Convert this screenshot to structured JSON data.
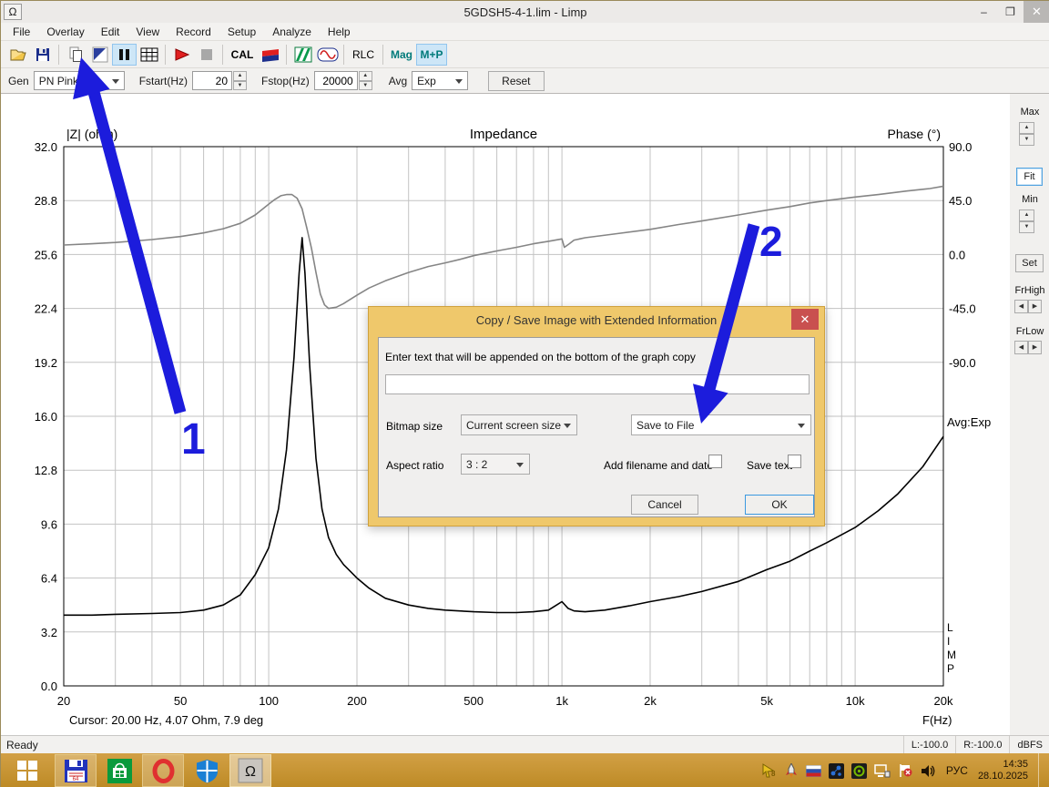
{
  "window": {
    "title": "5GDSH5-4-1.lim - Limp",
    "app_icon": "Ω"
  },
  "menu": {
    "items": [
      "File",
      "Overlay",
      "Edit",
      "View",
      "Record",
      "Setup",
      "Analyze",
      "Help"
    ]
  },
  "toolbar": {
    "icons": [
      "open-icon",
      "save-icon",
      "copy-icon",
      "pen-icon",
      "pause-icon",
      "table-icon",
      "record-icon",
      "stop-icon",
      "cal-button",
      "gen-flag-icon",
      "spectrum-icon",
      "generator-icon",
      "rlc-button",
      "mag-button",
      "mag-phase-button"
    ],
    "cal_label": "CAL",
    "rlc_label": "RLC",
    "mag_label": "Mag",
    "mp_label": "M+P"
  },
  "controls": {
    "gen_label": "Gen",
    "gen_value": "PN Pink",
    "fstart_label": "Fstart(Hz)",
    "fstart_value": "20",
    "fstop_label": "Fstop(Hz)",
    "fstop_value": "20000",
    "avg_label": "Avg",
    "avg_value": "Exp",
    "reset_label": "Reset"
  },
  "side_panel": {
    "max_label": "Max",
    "fit_label": "Fit",
    "min_label": "Min",
    "set_label": "Set",
    "frhigh_label": "FrHigh",
    "frlow_label": "FrLow"
  },
  "chart_data": {
    "type": "line",
    "title": "Impedance",
    "left_axis": {
      "label": "|Z| (ohm)",
      "range": [
        0,
        32
      ],
      "ticks": [
        "32.0",
        "28.8",
        "25.6",
        "22.4",
        "19.2",
        "16.0",
        "12.8",
        "9.6",
        "6.4",
        "3.2",
        "0.0"
      ]
    },
    "right_axis": {
      "label": "Phase (°)",
      "range": [
        -90,
        90
      ],
      "ticks": [
        "90.0",
        "45.0",
        "0.0",
        "-45.0",
        "-90.0"
      ]
    },
    "x_axis": {
      "label": "F(Hz)",
      "scale": "log",
      "range": [
        20,
        20000
      ],
      "ticks": [
        {
          "label": "20",
          "f": 20
        },
        {
          "label": "50",
          "f": 50
        },
        {
          "label": "100",
          "f": 100
        },
        {
          "label": "200",
          "f": 200
        },
        {
          "label": "500",
          "f": 500
        },
        {
          "label": "1k",
          "f": 1000
        },
        {
          "label": "2k",
          "f": 2000
        },
        {
          "label": "5k",
          "f": 5000
        },
        {
          "label": "10k",
          "f": 10000
        },
        {
          "label": "20k",
          "f": 20000
        }
      ]
    },
    "cursor_readout": "Cursor: 20.00 Hz, 4.07 Ohm, 7.9 deg",
    "avg_note": "Avg:Exp",
    "watermark": "LIMP",
    "grid": true,
    "series": [
      {
        "name": "impedance",
        "axis": "left",
        "color": "#000000",
        "unit": "Ohm",
        "points": [
          [
            20,
            4.2
          ],
          [
            25,
            4.2
          ],
          [
            30,
            4.25
          ],
          [
            40,
            4.3
          ],
          [
            50,
            4.35
          ],
          [
            60,
            4.5
          ],
          [
            70,
            4.8
          ],
          [
            80,
            5.4
          ],
          [
            90,
            6.6
          ],
          [
            100,
            8.2
          ],
          [
            108,
            10.5
          ],
          [
            115,
            14
          ],
          [
            122,
            19.5
          ],
          [
            127,
            24.5
          ],
          [
            130,
            26.6
          ],
          [
            133,
            24.5
          ],
          [
            138,
            19
          ],
          [
            145,
            13.5
          ],
          [
            152,
            10.5
          ],
          [
            160,
            8.8
          ],
          [
            170,
            7.8
          ],
          [
            180,
            7.2
          ],
          [
            200,
            6.4
          ],
          [
            220,
            5.8
          ],
          [
            250,
            5.2
          ],
          [
            300,
            4.8
          ],
          [
            350,
            4.6
          ],
          [
            400,
            4.5
          ],
          [
            500,
            4.4
          ],
          [
            600,
            4.35
          ],
          [
            700,
            4.35
          ],
          [
            800,
            4.4
          ],
          [
            850,
            4.45
          ],
          [
            900,
            4.5
          ],
          [
            950,
            4.75
          ],
          [
            1000,
            5.0
          ],
          [
            1050,
            4.6
          ],
          [
            1100,
            4.45
          ],
          [
            1200,
            4.4
          ],
          [
            1400,
            4.5
          ],
          [
            1700,
            4.75
          ],
          [
            2000,
            5.0
          ],
          [
            2500,
            5.3
          ],
          [
            3000,
            5.6
          ],
          [
            4000,
            6.2
          ],
          [
            5000,
            6.9
          ],
          [
            6000,
            7.4
          ],
          [
            7000,
            8.0
          ],
          [
            8000,
            8.5
          ],
          [
            10000,
            9.4
          ],
          [
            12000,
            10.4
          ],
          [
            14000,
            11.4
          ],
          [
            17000,
            13.0
          ],
          [
            20000,
            14.8
          ]
        ]
      },
      {
        "name": "phase",
        "axis": "right",
        "color": "#858585",
        "unit": "deg",
        "points": [
          [
            20,
            7.9
          ],
          [
            25,
            9
          ],
          [
            30,
            10
          ],
          [
            40,
            12.5
          ],
          [
            50,
            15
          ],
          [
            60,
            18
          ],
          [
            70,
            21.5
          ],
          [
            80,
            26
          ],
          [
            90,
            33
          ],
          [
            100,
            42
          ],
          [
            105,
            46
          ],
          [
            110,
            49
          ],
          [
            115,
            50
          ],
          [
            120,
            50
          ],
          [
            125,
            47
          ],
          [
            130,
            38
          ],
          [
            135,
            22
          ],
          [
            140,
            5
          ],
          [
            145,
            -15
          ],
          [
            150,
            -33
          ],
          [
            155,
            -42
          ],
          [
            160,
            -45
          ],
          [
            170,
            -44
          ],
          [
            180,
            -41
          ],
          [
            200,
            -34
          ],
          [
            220,
            -28
          ],
          [
            250,
            -22
          ],
          [
            300,
            -15
          ],
          [
            350,
            -10
          ],
          [
            400,
            -7
          ],
          [
            450,
            -4
          ],
          [
            500,
            -1
          ],
          [
            600,
            3
          ],
          [
            700,
            6
          ],
          [
            800,
            9
          ],
          [
            900,
            11
          ],
          [
            1000,
            13
          ],
          [
            1020,
            6
          ],
          [
            1060,
            9
          ],
          [
            1100,
            12
          ],
          [
            1200,
            14
          ],
          [
            1500,
            17
          ],
          [
            2000,
            21
          ],
          [
            2500,
            25
          ],
          [
            3000,
            28
          ],
          [
            4000,
            33
          ],
          [
            5000,
            37
          ],
          [
            6000,
            40
          ],
          [
            7000,
            43
          ],
          [
            8000,
            45
          ],
          [
            10000,
            48
          ],
          [
            12000,
            50
          ],
          [
            15000,
            53
          ],
          [
            18000,
            55
          ],
          [
            20000,
            57
          ]
        ]
      }
    ]
  },
  "dialog": {
    "title": "Copy / Save Image with Extended Information",
    "close_icon": "✕",
    "prompt": "Enter text that will be appended on the bottom of the graph copy",
    "text_value": "",
    "bitmap_size_label": "Bitmap size",
    "bitmap_size_value": "Current screen size",
    "save_mode_value": "Save to File",
    "aspect_label": "Aspect ratio",
    "aspect_value": "3 : 2",
    "add_filename_label": "Add filename and date",
    "save_text_label": "Save text",
    "cancel_label": "Cancel",
    "ok_label": "OK"
  },
  "annotations": {
    "arrow1_label": "1",
    "arrow2_label": "2",
    "arrow_color": "#1c1cdc"
  },
  "statusbar": {
    "ready": "Ready",
    "left_level": "L:-100.0",
    "right_level": "R:-100.0",
    "unit": "dBFS"
  },
  "taskbar": {
    "pinned_icons": [
      "start-button",
      "floppy-backup-icon",
      "store-icon",
      "opera-icon",
      "defender-icon",
      "limp-omega-icon"
    ],
    "tray_icons": [
      "pointer-8-icon",
      "rocket-icon",
      "ru-flag-icon",
      "molecule-icon",
      "nvidia-icon",
      "network-icon",
      "action-center-flag-icon",
      "speaker-icon"
    ],
    "tray": {
      "lang": "РУС",
      "time": "14:35",
      "date": "28.10.2025"
    }
  }
}
